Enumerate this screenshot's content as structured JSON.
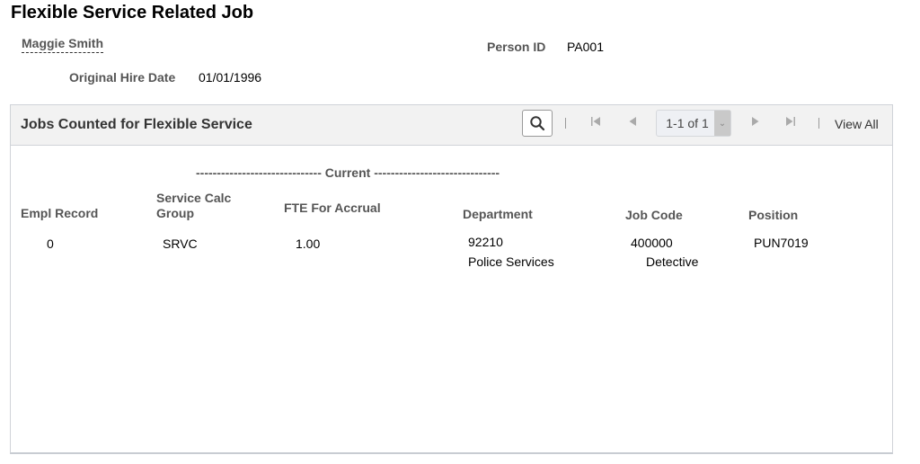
{
  "page": {
    "title": "Flexible Service Related Job",
    "employee_name": "Maggie Smith",
    "person_id_label": "Person ID",
    "person_id": "PA001",
    "hire_date_label": "Original Hire Date",
    "hire_date": "01/01/1996"
  },
  "grid": {
    "title": "Jobs Counted for Flexible Service",
    "search_icon": "search-icon",
    "pager_text": "1-1 of 1",
    "view_all": "View All",
    "group_header": "------------------------------ Current ------------------------------",
    "columns": {
      "empl_record": "Empl Record",
      "service_calc_group_1": "Service Calc",
      "service_calc_group_2": "Group",
      "fte": "FTE For Accrual",
      "department": "Department",
      "job_code": "Job Code",
      "position": "Position"
    },
    "rows": [
      {
        "empl_record": "0",
        "service_calc_group": "SRVC",
        "fte": "1.00",
        "department_code": "92210",
        "department_name": "Police Services",
        "job_code": "400000",
        "job_title": "Detective",
        "position": "PUN7019"
      }
    ]
  }
}
